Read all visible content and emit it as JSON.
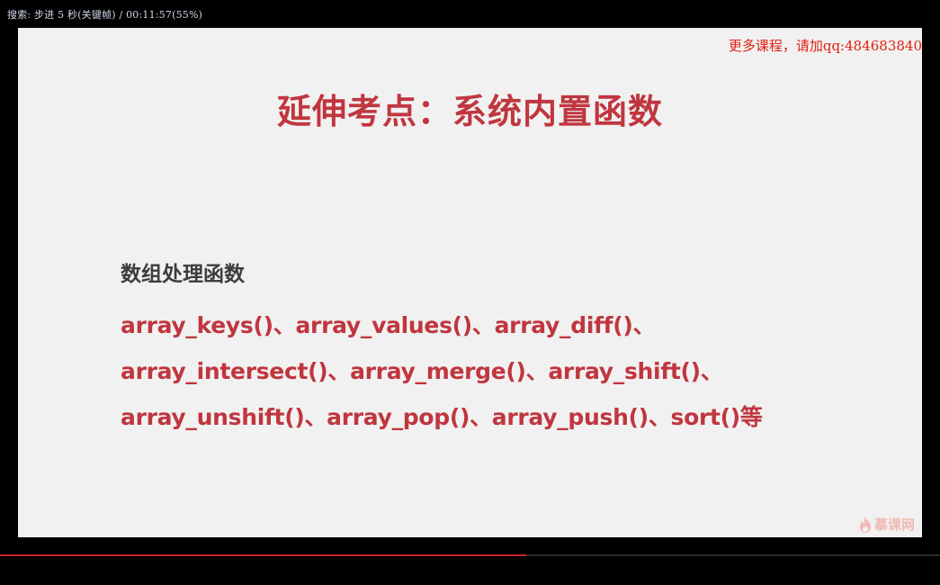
{
  "osd": {
    "text": "搜索: 步进 5 秒(关键帧) / 00:11:57(55%)"
  },
  "watermark": {
    "text": "更多课程，请加qq:484683840"
  },
  "slide": {
    "title": "延伸考点：系统内置函数",
    "section_heading": "数组处理函数",
    "lines": [
      "array_keys()、array_values()、array_diff()、",
      "array_intersect()、array_merge()、array_shift()、",
      "array_unshift()、array_pop()、array_push()、sort()等"
    ],
    "logo": {
      "icon": "flame-icon",
      "text": "慕课网"
    }
  },
  "playback": {
    "progress_percent": 56
  },
  "colors": {
    "title_red": "#c0363f",
    "heading_gray": "#3d3d3d",
    "watermark_red": "#e02010",
    "progress_red": "#c9232a",
    "slide_bg": "#f1f1f1"
  }
}
